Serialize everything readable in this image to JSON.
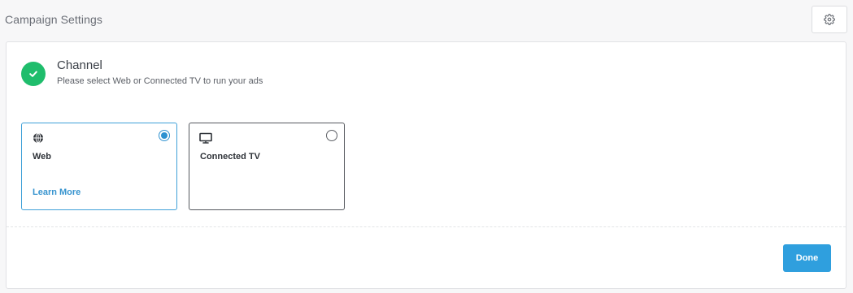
{
  "header": {
    "title": "Campaign Settings",
    "settings_icon": "gear-icon"
  },
  "channel": {
    "status_icon": "check-circle-icon",
    "status_color": "#1fbd6c",
    "title": "Channel",
    "subtitle": "Please select Web or Connected TV to run your ads",
    "options": [
      {
        "label": "Web",
        "icon": "globe-icon",
        "selected": true,
        "link_label": "Learn More"
      },
      {
        "label": "Connected TV",
        "icon": "tv-icon",
        "selected": false
      }
    ]
  },
  "footer": {
    "done_label": "Done"
  },
  "colors": {
    "accent": "#2f9fde",
    "selected_border": "#3fa0d8",
    "success": "#1fbd6c"
  }
}
